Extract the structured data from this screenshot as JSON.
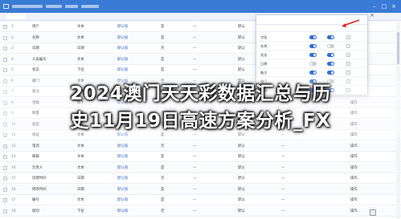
{
  "headline": {
    "line1": "2024澳门天天彩数据汇总与历",
    "line2": "史11月19日高速方案分析_FX"
  },
  "colors": {
    "titlebar": "#3a7bd5",
    "accent": "#2f6fd6",
    "arrow": "#e02020"
  },
  "grid": {
    "rows": [
      {
        "c0": "1",
        "c1": "用户",
        "c2": "文本",
        "c3": "默认值",
        "c4": "是",
        "c5": "—",
        "c6": "默认",
        "c7": "—",
        "c8": "操作"
      },
      {
        "c0": "2",
        "c1": "名称",
        "c2": "文本",
        "c3": "默认值",
        "c4": "是",
        "c5": "—",
        "c6": "默认",
        "c7": "—",
        "c8": "操作"
      },
      {
        "c0": "3",
        "c1": "日期",
        "c2": "日期",
        "c3": "默认值",
        "c4": "否",
        "c5": "—",
        "c6": "默认",
        "c7": "—",
        "c8": "操作"
      },
      {
        "c0": "4",
        "c1": "人员编号",
        "c2": "文本",
        "c3": "默认值",
        "c4": "是",
        "c5": "—",
        "c6": "默认",
        "c7": "—",
        "c8": "操作"
      },
      {
        "c0": "5",
        "c1": "状态",
        "c2": "下拉",
        "c3": "默认值",
        "c4": "是",
        "c5": "—",
        "c6": "默认",
        "c7": "—",
        "c8": "操作"
      },
      {
        "c0": "6",
        "c1": "部门",
        "c2": "文本",
        "c3": "默认值",
        "c4": "否",
        "c5": "—",
        "c6": "默认",
        "c7": "—",
        "c8": "操作"
      },
      {
        "c0": "7",
        "c1": "备注",
        "c2": "文本",
        "c3": "默认值",
        "c4": "是",
        "c5": "—",
        "c6": "默认",
        "c7": "—",
        "c8": "操作"
      },
      {
        "c0": "8",
        "c1": "金额",
        "c2": "数字",
        "c3": "默认值",
        "c4": "是",
        "c5": "—",
        "c6": "默认",
        "c7": "—",
        "c8": "操作"
      },
      {
        "c0": "9",
        "c1": "数量",
        "c2": "数字",
        "c3": "默认值",
        "c4": "否",
        "c5": "—",
        "c6": "默认",
        "c7": "—",
        "c8": "操作"
      },
      {
        "c0": "10",
        "c1": "类型",
        "c2": "下拉",
        "c3": "默认值",
        "c4": "是",
        "c5": "—",
        "c6": "默认",
        "c7": "—",
        "c8": "操作"
      },
      {
        "c0": "11",
        "c1": "地址",
        "c2": "文本",
        "c3": "默认值",
        "c4": "是",
        "c5": "—",
        "c6": "默认",
        "c7": "—",
        "c8": "操作"
      },
      {
        "c0": "12",
        "c1": "电话",
        "c2": "文本",
        "c3": "默认值",
        "c4": "否",
        "c5": "—",
        "c6": "默认",
        "c7": "—",
        "c8": "操作"
      },
      {
        "c0": "13",
        "c1": "邮箱",
        "c2": "文本",
        "c3": "默认值",
        "c4": "是",
        "c5": "—",
        "c6": "默认",
        "c7": "—",
        "c8": "操作"
      },
      {
        "c0": "14",
        "c1": "负责人",
        "c2": "文本",
        "c3": "默认值",
        "c4": "是",
        "c5": "—",
        "c6": "默认",
        "c7": "—",
        "c8": "操作"
      },
      {
        "c0": "15",
        "c1": "创建时间",
        "c2": "日期",
        "c3": "默认值",
        "c4": "否",
        "c5": "—",
        "c6": "默认",
        "c7": "—",
        "c8": "操作"
      },
      {
        "c0": "16",
        "c1": "修改时间",
        "c2": "日期",
        "c3": "默认值",
        "c4": "是",
        "c5": "—",
        "c6": "默认",
        "c7": "—",
        "c8": "操作"
      },
      {
        "c0": "17",
        "c1": "编号",
        "c2": "文本",
        "c3": "默认值",
        "c4": "是",
        "c5": "—",
        "c6": "默认",
        "c7": "—",
        "c8": "操作"
      },
      {
        "c0": "18",
        "c1": "级别",
        "c2": "下拉",
        "c3": "默认值",
        "c4": "否",
        "c5": "—",
        "c6": "默认",
        "c7": "—",
        "c8": "操作"
      }
    ]
  },
  "panel": {
    "rows": [
      {
        "label": "字段",
        "a": "on",
        "b": "on"
      },
      {
        "label": "名称",
        "a": "on",
        "b": "off"
      },
      {
        "label": "状态",
        "a": "on",
        "b": "on"
      },
      {
        "label": "日期",
        "a": "off",
        "b": "on"
      },
      {
        "label": "备注",
        "a": "on",
        "b": "on"
      },
      {
        "label": "部门",
        "a": "on",
        "b": "off"
      },
      {
        "label": "金额",
        "a": "on",
        "b": "on"
      }
    ]
  }
}
